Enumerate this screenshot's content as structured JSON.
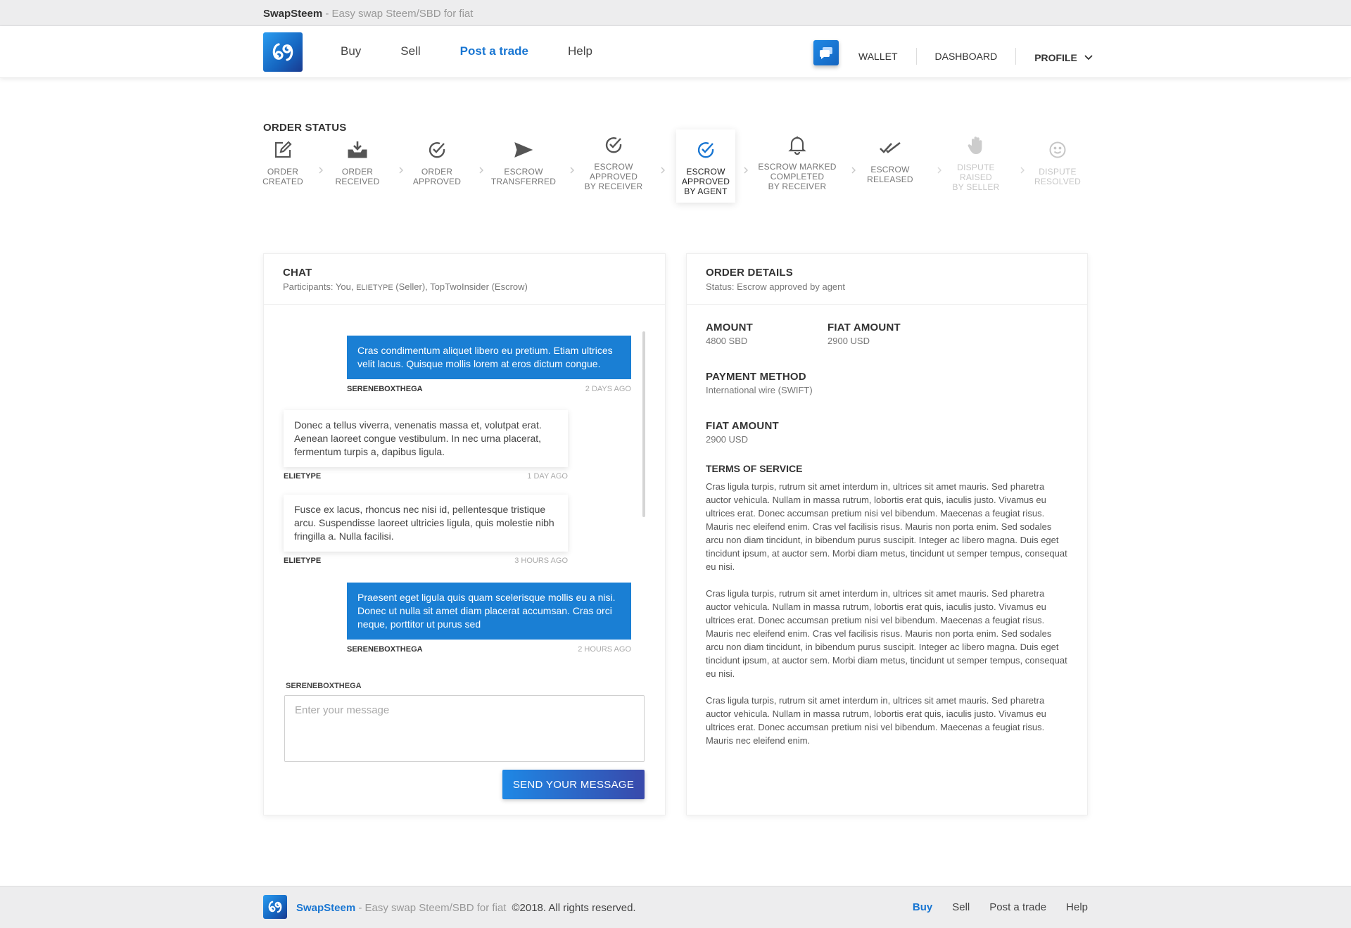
{
  "topbar": {
    "brand": "SwapSteem",
    "tagline": " - Easy swap Steem/SBD for fiat"
  },
  "nav": {
    "buy": "Buy",
    "sell": "Sell",
    "post": "Post a trade",
    "help": "Help"
  },
  "right_nav": {
    "wallet": "WALLET",
    "dashboard": "DASHBOARD",
    "profile": "PROFILE"
  },
  "order_status": {
    "title": "ORDER STATUS",
    "steps": [
      {
        "label1": "ORDER",
        "label2": "CREATED",
        "icon": "edit-icon",
        "state": "done"
      },
      {
        "label1": "ORDER",
        "label2": "RECEIVED",
        "icon": "inbox-download-icon",
        "state": "done"
      },
      {
        "label1": "ORDER",
        "label2": "APPROVED",
        "icon": "check-circle-icon",
        "state": "done"
      },
      {
        "label1": "ESCROW",
        "label2": "TRANSFERRED",
        "icon": "send-icon",
        "state": "done"
      },
      {
        "label1": "ESCROW",
        "label2": "APPROVED",
        "label3": "BY RECEIVER",
        "icon": "check-circle-icon",
        "state": "done"
      },
      {
        "label1": "ESCROW",
        "label2": "APPROVED",
        "label3": "BY AGENT",
        "icon": "check-circle-icon",
        "state": "active"
      },
      {
        "label1": "ESCROW MARKED",
        "label2": "COMPLETED",
        "label3": "BY RECEIVER",
        "icon": "bell-icon",
        "state": "done"
      },
      {
        "label1": "ESCROW",
        "label2": "RELEASED",
        "icon": "double-check-icon",
        "state": "done"
      },
      {
        "label1": "DISPUTE",
        "label2": "RAISED",
        "label3": "BY SELLER",
        "icon": "hand-icon",
        "state": "todo"
      },
      {
        "label1": "DISPUTE",
        "label2": "RESOLVED",
        "icon": "smile-icon",
        "state": "todo"
      }
    ]
  },
  "chat": {
    "title": "CHAT",
    "participants_prefix": "Participants: You, ",
    "participants_seller": "ELIETYPE",
    "participants_suffix": " (Seller), TopTwoInsider (Escrow)",
    "messages": [
      {
        "text": "Cras condimentum aliquet libero eu pretium. Etiam ultrices velit lacus. Quisque mollis lorem at eros dictum congue.",
        "author": "SERENEBOXTHEGA",
        "time": "2 DAYS AGO"
      },
      {
        "text": "Donec a tellus viverra, venenatis massa et, volutpat erat. Aenean laoreet congue vestibulum. In nec urna placerat, fermentum turpis a, dapibus ligula.",
        "author": "ELIETYPE",
        "time": "1 DAY AGO"
      },
      {
        "text": "Fusce ex lacus, rhoncus nec nisi id, pellentesque tristique arcu. Suspendisse laoreet ultricies ligula, quis molestie nibh fringilla a. Nulla facilisi.",
        "author": "ELIETYPE",
        "time": "3 HOURS AGO"
      },
      {
        "text": "Praesent eget ligula quis quam scelerisque mollis eu a nisi. Donec ut nulla sit amet diam placerat accumsan. Cras orci neque, porttitor ut purus sed",
        "author": "SERENEBOXTHEGA",
        "time": "2 HOURS AGO"
      }
    ],
    "input_label": "SERENEBOXTHEGA",
    "input_placeholder": "Enter your message",
    "input_value": "",
    "send_label": "SEND YOUR MESSAGE"
  },
  "details": {
    "title": "ORDER DETAILS",
    "status": "Status: Escrow approved by agent",
    "amount_label": "AMOUNT",
    "amount_value": "4800 SBD",
    "fiat_label": "FIAT AMOUNT",
    "fiat_value": "2900 USD",
    "payment_label": "PAYMENT METHOD",
    "payment_value": "International wire (SWIFT)",
    "fiat2_label": "FIAT AMOUNT",
    "fiat2_value": "2900 USD",
    "tos_title": "TERMS OF SERVICE",
    "tos": [
      "Cras ligula turpis, rutrum sit amet interdum in, ultrices sit amet mauris. Sed pharetra auctor vehicula. Nullam in massa rutrum, lobortis erat quis, iaculis justo. Vivamus eu ultrices erat. Donec accumsan pretium nisi vel bibendum. Maecenas a feugiat risus. Mauris nec eleifend enim. Cras vel facilisis risus. Mauris non porta enim. Sed sodales arcu non diam tincidunt, in bibendum purus suscipit. Integer ac libero magna. Duis eget tincidunt ipsum, at auctor sem. Morbi diam metus, tincidunt ut semper tempus, consequat eu nisi.",
      "Cras ligula turpis, rutrum sit amet interdum in, ultrices sit amet mauris. Sed pharetra auctor vehicula. Nullam in massa rutrum, lobortis erat quis, iaculis justo. Vivamus eu ultrices erat. Donec accumsan pretium nisi vel bibendum. Maecenas a feugiat risus. Mauris nec eleifend enim. Cras vel facilisis risus. Mauris non porta enim. Sed sodales arcu non diam tincidunt, in bibendum purus suscipit. Integer ac libero magna. Duis eget tincidunt ipsum, at auctor sem. Morbi diam metus, tincidunt ut semper tempus, consequat eu nisi.",
      "Cras ligula turpis, rutrum sit amet interdum in, ultrices sit amet mauris. Sed pharetra auctor vehicula. Nullam in massa rutrum, lobortis erat quis, iaculis justo. Vivamus eu ultrices erat. Donec accumsan pretium nisi vel bibendum. Maecenas a feugiat risus. Mauris nec eleifend enim."
    ]
  },
  "footer": {
    "brand": "SwapSteem",
    "tagline": " - Easy swap Steem/SBD for fiat",
    "copyright": "©2018. All rights reserved.",
    "buy": "Buy",
    "sell": "Sell",
    "post": "Post a trade",
    "help": "Help"
  },
  "colors": {
    "accent": "#1976d2",
    "message_out": "#1a7fd4",
    "muted": "#c6c6c6"
  }
}
